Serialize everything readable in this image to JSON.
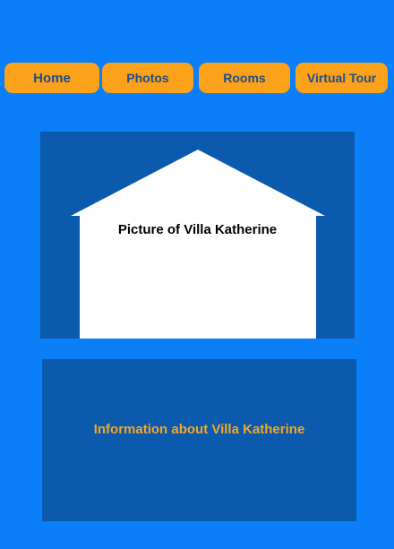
{
  "nav": {
    "items": [
      {
        "label": "Home"
      },
      {
        "label": "Photos"
      },
      {
        "label": "Rooms"
      },
      {
        "label": "Virtual Tour"
      }
    ]
  },
  "main": {
    "picture_caption": "Picture of Villa Katherine",
    "info_text": "Information about Villa Katherine"
  },
  "colors": {
    "background": "#0a7ff7",
    "panel": "#0b5aae",
    "button": "#fca11a",
    "button_text": "#1f4e8c",
    "info_text": "#f5a623"
  },
  "icons": [
    "house-placeholder-icon"
  ]
}
